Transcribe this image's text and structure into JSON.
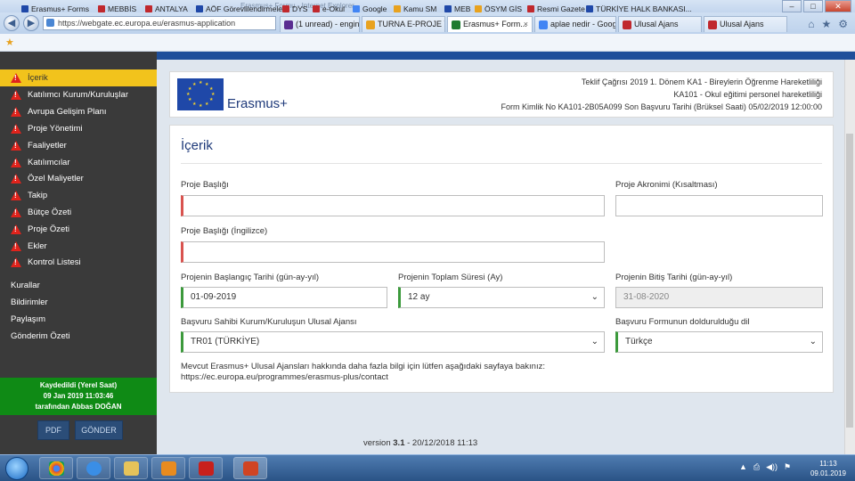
{
  "browser": {
    "window_caption": "Erasmus+ Formu - Internet Explorer",
    "url": "https://webgate.ec.europa.eu/erasmus-application",
    "tabs": [
      {
        "label": "(1 unread) - engin...",
        "color": "#5a2d91",
        "active": false
      },
      {
        "label": "TURNA E-PROJE Y...",
        "color": "#e8a21f",
        "active": false
      },
      {
        "label": "Erasmus+ Form...",
        "color": "#1f7b31",
        "active": true,
        "close": "×"
      },
      {
        "label": "aplae nedir - Goog...",
        "color": "#4285f4",
        "active": false
      },
      {
        "label": "Ulusal Ajans",
        "color": "#c0282d",
        "active": false
      },
      {
        "label": "Ulusal Ajans",
        "color": "#c0282d",
        "active": false
      }
    ],
    "window_buttons": {
      "minimize": "–",
      "maximize": "□",
      "close": "✕"
    },
    "chrome_icons": {
      "home": "⌂",
      "star": "★",
      "gear": "⚙"
    },
    "favorites": [
      {
        "label": "Erasmus+ Forms",
        "color": "#1f48a8"
      },
      {
        "label": "MEBBİS",
        "color": "#c0282d"
      },
      {
        "label": "ANTALYA",
        "color": "#c0282d"
      },
      {
        "label": "AÖF Görevlilendirmeler",
        "color": "#1f48a8"
      },
      {
        "label": "DYS",
        "color": "#c0282d"
      },
      {
        "label": "e-Okul",
        "color": "#c0282d"
      },
      {
        "label": "Google",
        "color": "#4285f4"
      },
      {
        "label": "Kamu SM",
        "color": "#e8a21f"
      },
      {
        "label": "MEB",
        "color": "#1f48a8"
      },
      {
        "label": "ÖSYM GİS",
        "color": "#e8a21f"
      },
      {
        "label": "Resmi Gazete",
        "color": "#c0282d"
      },
      {
        "label": "TÜRKİYE HALK BANKASI...",
        "color": "#1f48a8"
      }
    ]
  },
  "sidebar": {
    "items": [
      {
        "label": "İçerik",
        "active": true
      },
      {
        "label": "Katılımcı Kurum/Kuruluşlar"
      },
      {
        "label": "Avrupa Gelişim Planı"
      },
      {
        "label": "Proje Yönetimi"
      },
      {
        "label": "Faaliyetler"
      },
      {
        "label": "Katılımcılar"
      },
      {
        "label": "Özel Maliyetler"
      },
      {
        "label": "Takip"
      },
      {
        "label": "Bütçe Özeti"
      },
      {
        "label": "Proje Özeti"
      },
      {
        "label": "Ekler"
      },
      {
        "label": "Kontrol Listesi"
      }
    ],
    "links": [
      "Kurallar",
      "Bildirimler",
      "Paylaşım",
      "Gönderim Özeti"
    ],
    "saved": {
      "line1": "Kaydedildi (Yerel Saat)",
      "line2": "09 Jan 2019 11:03:46",
      "line3": "tarafından Abbas DOĞAN"
    },
    "pdf_button": "PDF",
    "send_button": "GÖNDER"
  },
  "header": {
    "brand": "Erasmus+",
    "line1": "Teklif Çağrısı 2019 1. Dönem KA1 - Bireylerin Öğrenme Hareketliliği",
    "line2": "KA101 - Okul eğitimi personel hareketliliği",
    "line3": "Form Kimlik No KA101-2B05A099 Son Başvuru Tarihi (Brüksel Saati) 05/02/2019 12:00:00"
  },
  "form": {
    "title": "İçerik",
    "project_title_label": "Proje Başlığı",
    "project_title_value": "",
    "acronym_label": "Proje Akronimi (Kısaltması)",
    "acronym_value": "",
    "title_en_label": "Proje Başlığı (İngilizce)",
    "title_en_value": "",
    "start_date_label": "Projenin Başlangıç Tarihi (gün-ay-yıl)",
    "start_date_value": "01-09-2019",
    "duration_label": "Projenin Toplam Süresi (Ay)",
    "duration_value": "12 ay",
    "end_date_label": "Projenin Bitiş Tarihi (gün-ay-yıl)",
    "end_date_value": "31-08-2020",
    "agency_label": "Başvuru Sahibi Kurum/Kuruluşun Ulusal Ajansı",
    "agency_value": "TR01 (TÜRKİYE)",
    "language_label": "Başvuru Formunun doldurulduğu dil",
    "language_value": "Türkçe",
    "note_line1": "Mevcut Erasmus+ Ulusal Ajansları hakkında daha fazla bilgi için lütfen aşağıdaki sayfaya bakınız:",
    "note_line2": "https://ec.europa.eu/programmes/erasmus-plus/contact",
    "caret": "⌄"
  },
  "footer": {
    "version_prefix": "version",
    "version_number": "3.1",
    "version_suffix": "- 20/12/2018 11:13"
  },
  "taskbar": {
    "apps": [
      {
        "name": "chrome",
        "color": "#dd4b39"
      },
      {
        "name": "internet-explorer",
        "color": "#3a8ee6"
      },
      {
        "name": "file-explorer",
        "color": "#e6c35a"
      },
      {
        "name": "media-player",
        "color": "#e88b1f"
      },
      {
        "name": "acrobat",
        "color": "#c8201c"
      },
      {
        "name": "powerpoint",
        "color": "#d04423"
      }
    ],
    "tray_icons": [
      "▲",
      "⎙",
      "◀))",
      "⚑"
    ],
    "time": "11:13",
    "date": "09.01.2019"
  }
}
